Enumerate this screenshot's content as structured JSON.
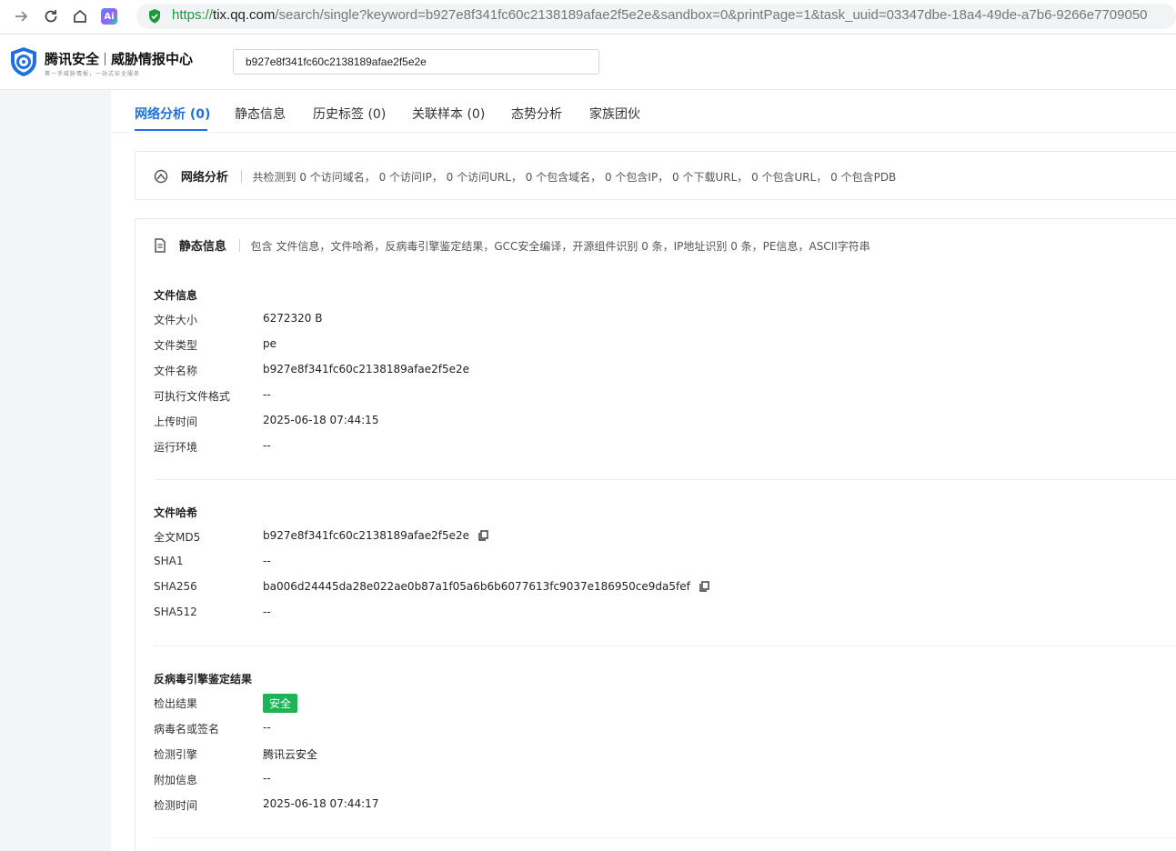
{
  "browser": {
    "url_protocol": "https://",
    "url_host": "tix.qq.com",
    "url_rest": "/search/single?keyword=b927e8f341fc60c2138189afae2f5e2e&sandbox=0&printPage=1&task_uuid=03347dbe-18a4-49de-a7b6-9266e7709050",
    "ai_label": "Ai"
  },
  "header": {
    "brand_left": "腾讯安全",
    "brand_right": "威胁情报中心",
    "brand_sub": "第一手威胁情报，一站式安全服务",
    "search_value": "b927e8f341fc60c2138189afae2f5e2e"
  },
  "tabs": [
    {
      "label": "网络分析 (0)"
    },
    {
      "label": "静态信息"
    },
    {
      "label": "历史标签 (0)"
    },
    {
      "label": "关联样本 (0)"
    },
    {
      "label": "态势分析"
    },
    {
      "label": "家族团伙"
    }
  ],
  "network": {
    "title": "网络分析",
    "summary": "共检测到 0 个访问域名， 0 个访问IP， 0 个访问URL， 0 个包含域名， 0 个包含IP， 0 个下载URL， 0 个包含URL， 0 个包含PDB"
  },
  "static": {
    "title": "静态信息",
    "summary": "包含 文件信息，文件哈希，反病毒引擎鉴定结果，GCC安全编译，开源组件识别 0 条，IP地址识别 0 条，PE信息，ASCII字符串",
    "file_info": {
      "title": "文件信息",
      "rows": [
        {
          "label": "文件大小",
          "value": "6272320 B"
        },
        {
          "label": "文件类型",
          "value": "pe"
        },
        {
          "label": "文件名称",
          "value": "b927e8f341fc60c2138189afae2f5e2e"
        },
        {
          "label": "可执行文件格式",
          "value": "--"
        },
        {
          "label": "上传时间",
          "value": "2025-06-18 07:44:15"
        },
        {
          "label": "运行环境",
          "value": "--"
        }
      ]
    },
    "file_hash": {
      "title": "文件哈希",
      "rows": [
        {
          "label": "全文MD5",
          "value": "b927e8f341fc60c2138189afae2f5e2e"
        },
        {
          "label": "SHA1",
          "value": "--"
        },
        {
          "label": "SHA256",
          "value": "ba006d24445da28e022ae0b87a1f05a6b6b6077613fc9037e186950ce9da5fef"
        },
        {
          "label": "SHA512",
          "value": "--"
        }
      ]
    },
    "antivirus": {
      "title": "反病毒引擎鉴定结果",
      "rows": [
        {
          "label": "检出结果",
          "value": "安全"
        },
        {
          "label": "病毒名或签名",
          "value": "--"
        },
        {
          "label": "检测引擎",
          "value": "腾讯云安全"
        },
        {
          "label": "附加信息",
          "value": "--"
        },
        {
          "label": "检测时间",
          "value": "2025-06-18 07:44:17"
        }
      ]
    }
  },
  "colors": {
    "accent": "#1f6fe0",
    "safe_badge": "#1fb357"
  }
}
